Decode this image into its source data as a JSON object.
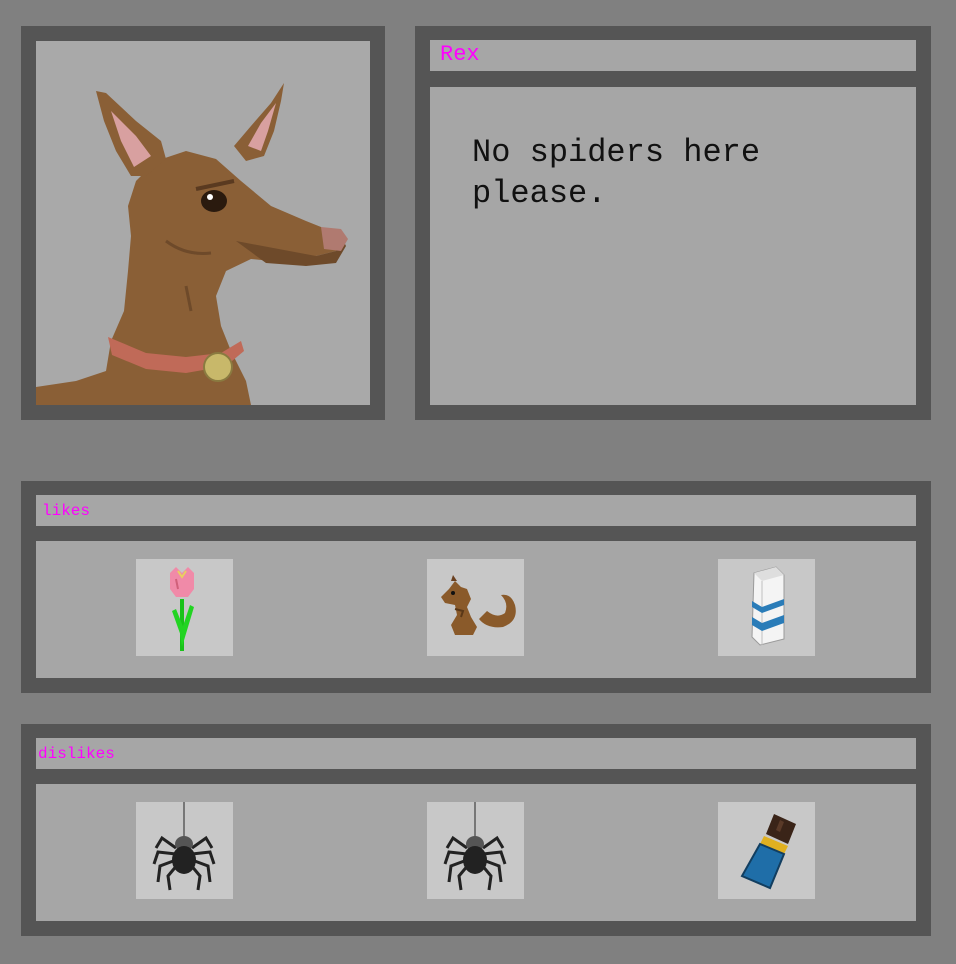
{
  "character": {
    "name": "Rex",
    "portrait_icon": "deer-portrait-icon"
  },
  "dialog": {
    "text": "No spiders here please."
  },
  "likes": {
    "title": "likes",
    "items": [
      {
        "icon": "tulip-icon"
      },
      {
        "icon": "squirrel-icon"
      },
      {
        "icon": "milk-carton-icon"
      }
    ]
  },
  "dislikes": {
    "title": "dislikes",
    "items": [
      {
        "icon": "spider-icon"
      },
      {
        "icon": "spider-icon"
      },
      {
        "icon": "chocolate-bar-icon"
      }
    ]
  },
  "colors": {
    "background": "#808080",
    "frame": "#555555",
    "panel": "#a6a6a6",
    "tile": "#c8c8c8",
    "label": "#ff00ff"
  }
}
